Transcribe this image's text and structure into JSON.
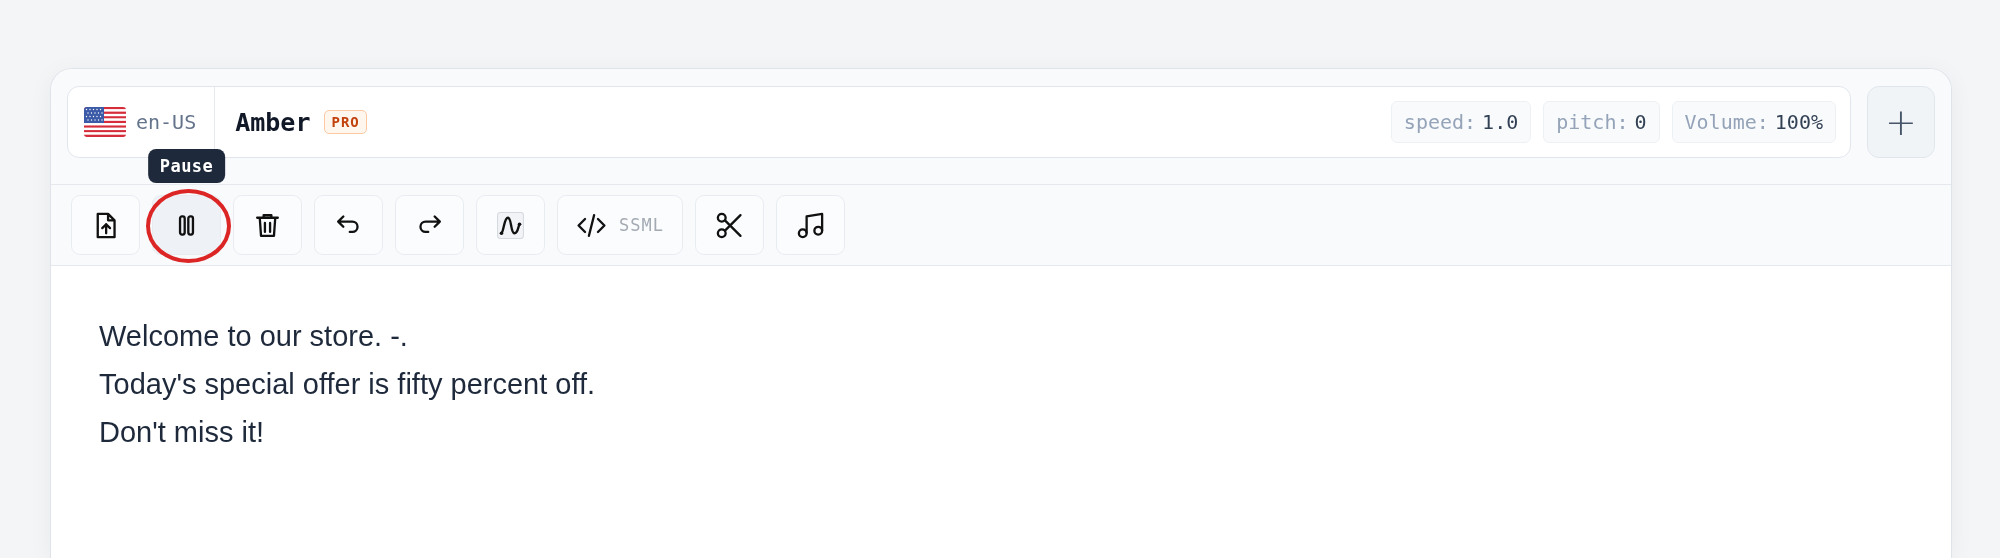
{
  "voice_bar": {
    "language": {
      "code": "en-US"
    },
    "voice": {
      "name": "Amber",
      "badge": "PRO"
    },
    "params": [
      {
        "label": "speed:",
        "value": "1.0"
      },
      {
        "label": "pitch:",
        "value": "0"
      },
      {
        "label": "Volume:",
        "value": "100%"
      }
    ],
    "add_button": "+"
  },
  "toolbar": [
    {
      "kind": "upload",
      "highlighted": false
    },
    {
      "kind": "pause",
      "highlighted": true,
      "tooltip": "Pause"
    },
    {
      "kind": "delete",
      "highlighted": false
    },
    {
      "kind": "undo",
      "highlighted": false
    },
    {
      "kind": "redo",
      "highlighted": false
    },
    {
      "kind": "curve",
      "highlighted": false
    },
    {
      "kind": "ssml",
      "label": "SSML",
      "highlighted": false
    },
    {
      "kind": "cut",
      "highlighted": false
    },
    {
      "kind": "music",
      "highlighted": false
    }
  ],
  "editor": {
    "lines": [
      "Welcome to our store. -.",
      "Today's special offer is fifty percent off.",
      "Don't miss it!"
    ]
  }
}
